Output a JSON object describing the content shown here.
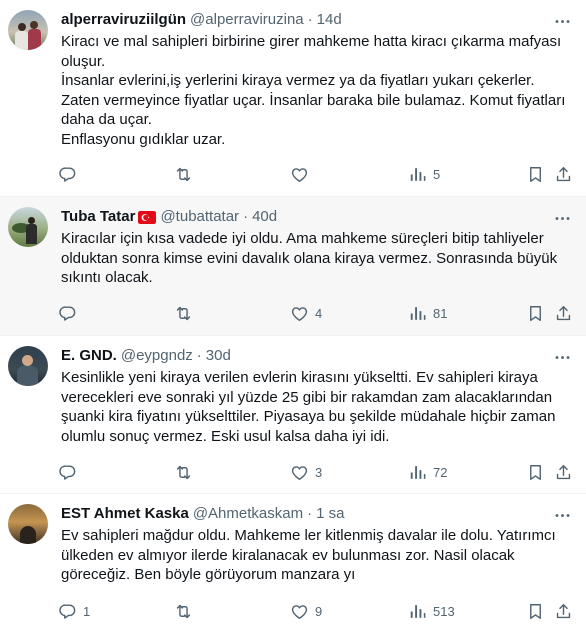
{
  "tweets": [
    {
      "name": "alperraviruziilgün",
      "handle": "@alperraviruzina",
      "dot": "·",
      "time": "14d",
      "text": "Kiracı ve mal sahipleri birbirine girer mahkeme hatta kiracı çıkarma mafyası oluşur.\nİnsanlar evlerini,iş yerlerini kiraya vermez ya da fiyatları yukarı çekerler.\nZaten vermeyince fiyatlar uçar. İnsanlar baraka bile bulamaz. Komut fiyatları daha da uçar.\nEnflasyonu gıdıklar uzar.",
      "replies": "",
      "retweets": "",
      "likes": "",
      "views": "5"
    },
    {
      "name": "Tuba Tatar",
      "handle": "@tubattatar",
      "dot": "·",
      "time": "40d",
      "text": "Kiracılar için kısa vadede iyi oldu. Ama mahkeme süreçleri bitip tahliyeler olduktan sonra kimse evini davalık olana kiraya vermez. Sonrasında büyük sıkıntı olacak.",
      "replies": "",
      "retweets": "",
      "likes": "4",
      "views": "81"
    },
    {
      "name": "E. GND.",
      "handle": "@eypgndz",
      "dot": "·",
      "time": "30d",
      "text": "Kesinlikle yeni kiraya verilen evlerin kirasını yükseltti. Ev sahipleri kiraya verecekleri eve sonraki yıl yüzde 25 gibi bir rakamdan zam alacaklarından şuanki kira fiyatını yükselttiler. Piyasaya bu şekilde müdahale hiçbir zaman olumlu sonuç vermez. Eski usul kalsa daha iyi idi.",
      "replies": "",
      "retweets": "",
      "likes": "3",
      "views": "72"
    },
    {
      "name": "EST Ahmet Kaska",
      "handle": "@Ahmetkaskam",
      "dot": "·",
      "time": "1 sa",
      "text": "Ev sahipleri mağdur oldu. Mahkeme ler kitlenmiş davalar ile dolu. Yatırımcı ülkeden ev almıyor ilerde kiralanacak ev bulunması zor. Nasil olacak göreceğiz. Ben böyle görüyorum manzara yı",
      "replies": "1",
      "retweets": "",
      "likes": "9",
      "views": "513"
    }
  ],
  "colors": {
    "text": "#0f1419",
    "secondary": "#536471",
    "divider": "#eff3f4",
    "highlight_bg": "#f7f7f7",
    "flag_red": "#e30a17"
  },
  "icons": [
    "more-icon",
    "reply-icon",
    "retweet-icon",
    "like-icon",
    "views-icon",
    "bookmark-icon",
    "share-icon",
    "turkey-flag-icon"
  ]
}
